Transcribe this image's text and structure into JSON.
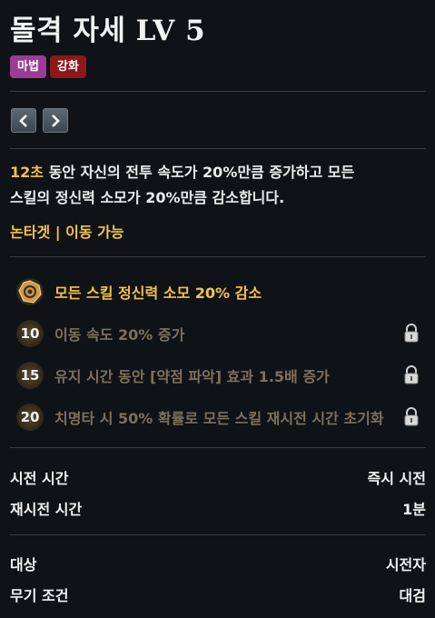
{
  "skill": {
    "title": "돌격 자세 LV 5"
  },
  "tags": [
    {
      "label": "마법",
      "color": "#9a3b96"
    },
    {
      "label": "강화",
      "color": "#8e1818"
    }
  ],
  "nav": {
    "prev_icon": "chevron-left-icon",
    "next_icon": "chevron-right-icon"
  },
  "description": {
    "highlight": "12초",
    "line1": " 동안 자신의 전투 속도가 20%만큼 증가하고 모든",
    "line2": "스킬의 정신력 소모가 20%만큼 감소합니다."
  },
  "nontarget_label": "논타겟 | 이동 가능",
  "traits": [
    {
      "level": "",
      "text": "모든 스킬 정신력 소모 20% 감소",
      "locked": false,
      "icon": "rune-icon"
    },
    {
      "level": "10",
      "text": "이동 속도 20% 증가",
      "locked": true
    },
    {
      "level": "15",
      "text": "유지 시간 동안 [약점 파악] 효과 1.5배 증가",
      "locked": true
    },
    {
      "level": "20",
      "text": "치명타 시 50% 확률로 모든 스킬 재시전 시간 초기화",
      "locked": true
    }
  ],
  "stats": [
    {
      "label": "시전 시간",
      "value": "즉시 시전"
    },
    {
      "label": "재시전 시간",
      "value": "1분"
    }
  ],
  "requirements": [
    {
      "label": "대상",
      "value": "시전자"
    },
    {
      "label": "무기 조건",
      "value": "대검"
    }
  ],
  "colors": {
    "highlight": "#f3c24a",
    "locked_text": "#7d715c",
    "background": "#0f1217"
  }
}
